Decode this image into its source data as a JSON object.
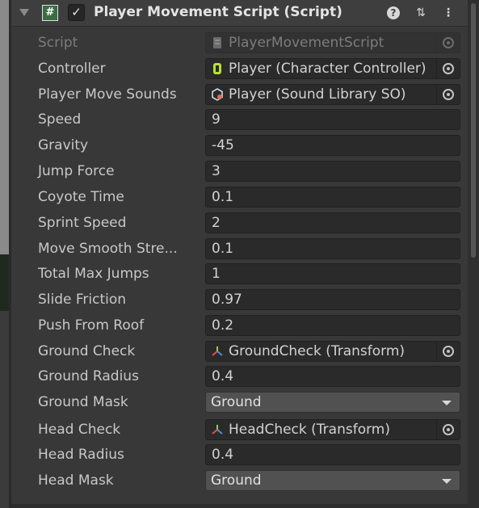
{
  "header": {
    "title": "Player Movement Script (Script)",
    "script_icon_glyph": "#",
    "check_glyph": "✓",
    "help_glyph": "?",
    "presets_glyph": "⇅",
    "menu_glyph": "⋮"
  },
  "fields": {
    "script": {
      "label": "Script",
      "value": "PlayerMovementScript"
    },
    "controller": {
      "label": "Controller",
      "value": "Player (Character Controller)"
    },
    "player_move_sounds": {
      "label": "Player Move Sounds",
      "value": "Player (Sound Library SO)"
    },
    "speed": {
      "label": "Speed",
      "value": "9"
    },
    "gravity": {
      "label": "Gravity",
      "value": "-45"
    },
    "jump_force": {
      "label": "Jump Force",
      "value": "3"
    },
    "coyote_time": {
      "label": "Coyote Time",
      "value": "0.1"
    },
    "sprint_speed": {
      "label": "Sprint Speed",
      "value": "2"
    },
    "move_smooth_strength": {
      "label": "Move Smooth Stre...",
      "value": "0.1"
    },
    "total_max_jumps": {
      "label": "Total Max Jumps",
      "value": "1"
    },
    "slide_friction": {
      "label": "Slide Friction",
      "value": "0.97"
    },
    "push_from_roof": {
      "label": "Push From Roof",
      "value": "0.2"
    },
    "ground_check": {
      "label": "Ground Check",
      "value": "GroundCheck (Transform)"
    },
    "ground_radius": {
      "label": "Ground Radius",
      "value": "0.4"
    },
    "ground_mask": {
      "label": "Ground Mask",
      "value": "Ground"
    },
    "head_check": {
      "label": "Head Check",
      "value": "HeadCheck (Transform)"
    },
    "head_radius": {
      "label": "Head Radius",
      "value": "0.4"
    },
    "head_mask": {
      "label": "Head Mask",
      "value": "Ground"
    }
  },
  "icons": {
    "component": "script-icon",
    "controller": "character-controller-icon",
    "sound": "scriptable-object-icon",
    "transform": "transform-icon"
  },
  "colors": {
    "panel_bg": "#383838",
    "field_bg": "#2a2a2a",
    "dropdown_bg": "#515151",
    "script_icon": "#3b6d42",
    "controller_icon": "#b6e03c"
  }
}
